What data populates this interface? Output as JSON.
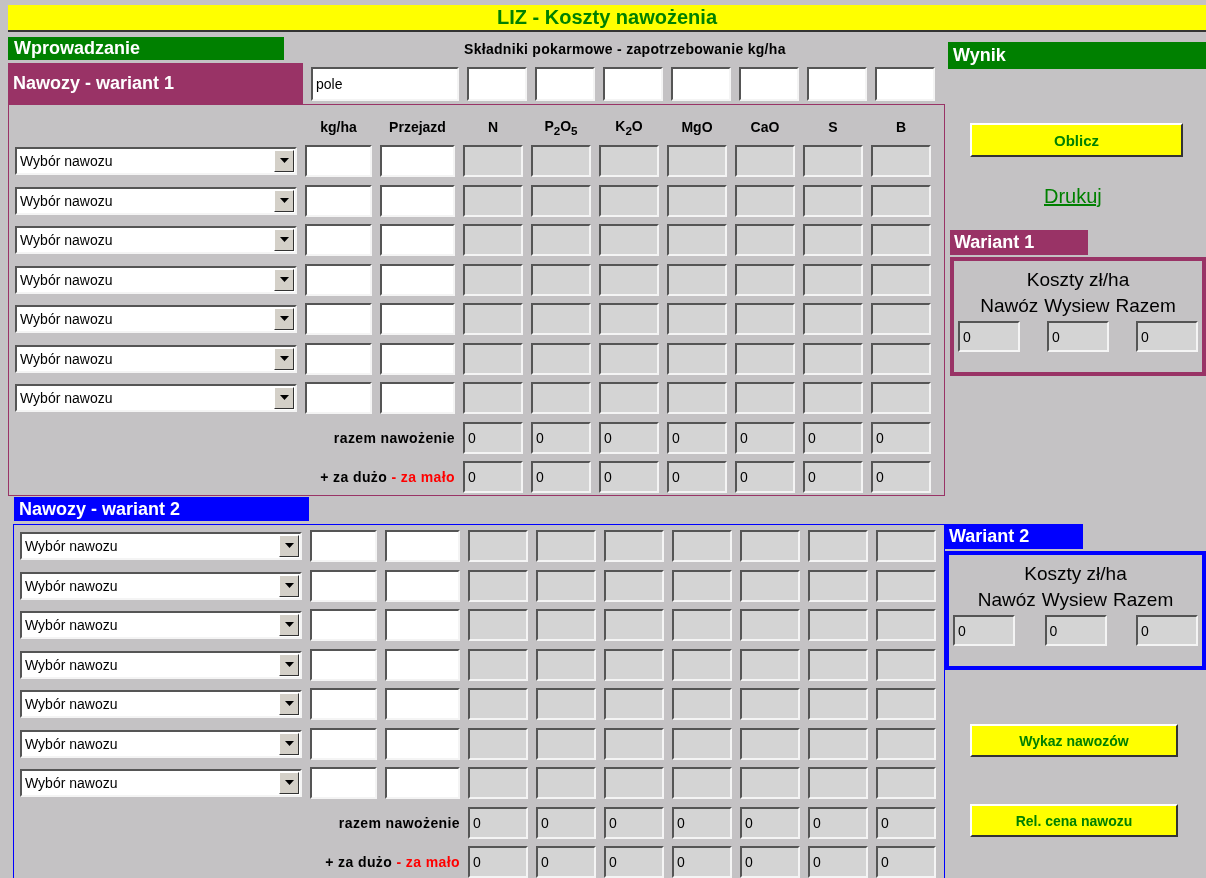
{
  "title": "LIZ - Koszty nawożenia",
  "intro": {
    "label": "Wprowadzanie",
    "caption": "Składniki pokarmowe - zapotrzebowanie kg/ha"
  },
  "field": {
    "value": "pole"
  },
  "variants": [
    {
      "title": "Nawozy - wariant 1",
      "color": "#993366",
      "columns": [
        "kg/ha",
        "Przejazd",
        "N",
        "P$_{2}$O$_{5}$",
        "K$_{2}$O",
        "MgO",
        "CaO",
        "S",
        "B"
      ],
      "rows": [
        {
          "select": "Wybór nawozu"
        },
        {
          "select": "Wybór nawozu"
        },
        {
          "select": "Wybór nawozu"
        },
        {
          "select": "Wybór nawozu"
        },
        {
          "select": "Wybór nawozu"
        },
        {
          "select": "Wybór nawozu"
        },
        {
          "select": "Wybór nawozu"
        }
      ],
      "total_label": "razem nawożenie",
      "totals": [
        "0",
        "0",
        "0",
        "0",
        "0",
        "0",
        "0"
      ],
      "plus_label": "+ za dużo",
      "minus_label": "- za mało",
      "diffs": [
        "0",
        "0",
        "0",
        "0",
        "0",
        "0",
        "0"
      ]
    },
    {
      "title": "Nawozy - wariant 2",
      "color": "#0000ff",
      "rows": [
        {
          "select": "Wybór nawozu"
        },
        {
          "select": "Wybór nawozu"
        },
        {
          "select": "Wybór nawozu"
        },
        {
          "select": "Wybór nawozu"
        },
        {
          "select": "Wybór nawozu"
        },
        {
          "select": "Wybór nawozu"
        },
        {
          "select": "Wybór nawozu"
        }
      ],
      "total_label": "razem nawożenie",
      "totals": [
        "0",
        "0",
        "0",
        "0",
        "0",
        "0",
        "0"
      ],
      "plus_label": "+ za dużo",
      "minus_label": "- za mało",
      "diffs": [
        "0",
        "0",
        "0",
        "0",
        "0",
        "0",
        "0"
      ]
    }
  ],
  "result": {
    "title": "Wynik",
    "calculate": "Oblicz",
    "print": "Drukuj",
    "costs": [
      {
        "title": "Wariant 1",
        "color": "#993366",
        "caption": "Koszty zł/ha",
        "headers": [
          "Nawóz",
          "Wysiew",
          "Razem"
        ],
        "values": [
          "0",
          "0",
          "0"
        ]
      },
      {
        "title": "Wariant 2",
        "color": "#0000ff",
        "caption": "Koszty zł/ha",
        "headers": [
          "Nawóz",
          "Wysiew",
          "Razem"
        ],
        "values": [
          "0",
          "0",
          "0"
        ]
      }
    ],
    "buttons": [
      "Wykaz nawozów",
      "Rel. cena  nawozu"
    ]
  }
}
